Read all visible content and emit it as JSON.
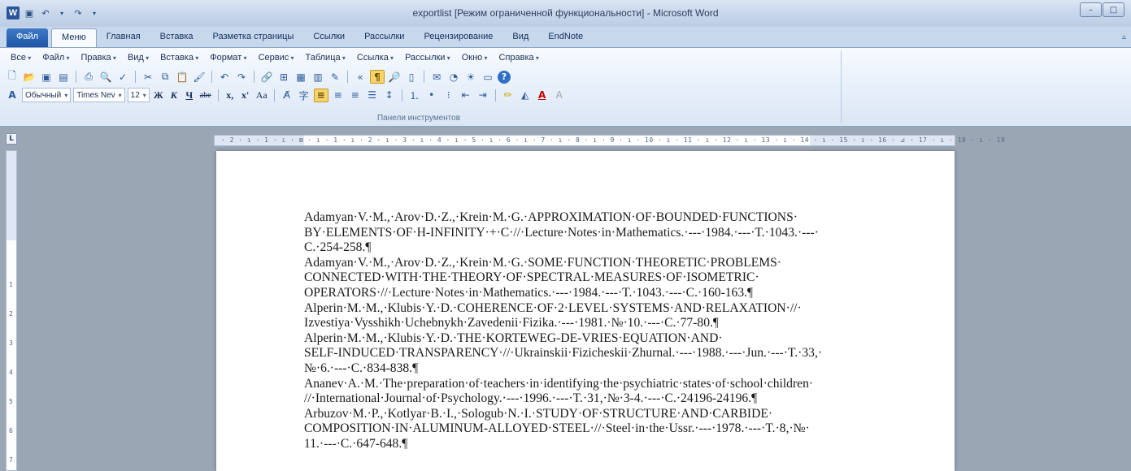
{
  "window": {
    "title": "exportlist [Режим ограниченной функциональности] - Microsoft Word",
    "qat_icons": [
      "word-logo",
      "save-icon",
      "undo-icon",
      "redo-icon",
      "customize-icon"
    ],
    "controls": {
      "minimize": "–",
      "maximize": "□"
    }
  },
  "tabs": [
    "Файл",
    "Меню",
    "Главная",
    "Вставка",
    "Разметка страницы",
    "Ссылки",
    "Рассылки",
    "Рецензирование",
    "Вид",
    "EndNote"
  ],
  "menu_bar": [
    "Все",
    "Файл",
    "Правка",
    "Вид",
    "Вставка",
    "Формат",
    "Сервис",
    "Таблица",
    "Ссылка",
    "Рассылки",
    "Окно",
    "Справка"
  ],
  "toolbar": {
    "style_combo": "Обычный",
    "font_combo": "Times Nev",
    "size_combo": "12",
    "bold": "Ж",
    "italic": "К",
    "underline": "Ч",
    "strike": "abe",
    "subscript": "x,",
    "superscript": "x'",
    "case": "Aa",
    "help": "?",
    "group_label": "Панели инструментов"
  },
  "ruler": {
    "h_marks": "· 2 · ı · 1 · ı · ⊠ · ı · 1 · ı · 2 · ı · 3 · ı · 4 · ı · 5 · ı · 6 · ı · 7 · ı · 8 · ı · 9 · ı · 10 · ı · 11 · ı · 12 · ı · 13 · ı · 14 · ı · 15 · ı · 16 · ⊿ · 17 · ı · 18 · ı · 19",
    "v_marks": [
      "1",
      "2",
      "3",
      "4",
      "5",
      "6",
      "7"
    ],
    "tab_selector": "L"
  },
  "document": {
    "lines": [
      "Adamyan·V.·M.,·Arov·D.·Z.,·Krein·M.·G.·APPROXIMATION·OF·BOUNDED·FUNCTIONS·",
      "BY·ELEMENTS·OF·H-INFINITY·+·C·//·Lecture·Notes·in·Mathematics.·---·1984.·---·T.·1043.·---·",
      "C.·254-258.¶",
      "Adamyan·V.·M.,·Arov·D.·Z.,·Krein·M.·G.·SOME·FUNCTION·THEORETIC·PROBLEMS·",
      "CONNECTED·WITH·THE·THEORY·OF·SPECTRAL·MEASURES·OF·ISOMETRIC·",
      "OPERATORS·//·Lecture·Notes·in·Mathematics.·---·1984.·---·T.·1043.·---·C.·160-163.¶",
      "Alperin·M.·M.,·Klubis·Y.·D.·COHERENCE·OF·2·LEVEL·SYSTEMS·AND·RELAXATION·//·",
      "Izvestiya·Vysshikh·Uchebnykh·Zavedenii·Fizika.·---·1981.·№·10.·---·C.·77-80.¶",
      "Alperin·M.·M.,·Klubis·Y.·D.·THE·KORTEWEG-DE-VRIES·EQUATION·AND·",
      "SELF-INDUCED·TRANSPARENCY·//·Ukrainskii·Fizicheskii·Zhurnal.·---·1988.·---·Jun.·---·T.·33,·",
      "№·6.·---·C.·834-838.¶",
      "Ananev·A.·M.·The·preparation·of·teachers·in·identifying·the·psychiatric·states·of·school·children·",
      "//·International·Journal·of·Psychology.·---·1996.·---·T.·31,·№·3-4.·---·C.·24196-24196.¶",
      "Arbuzov·M.·P.,·Kotlyar·B.·I.,·Sologub·N.·I.·STUDY·OF·STRUCTURE·AND·CARBIDE·",
      "COMPOSITION·IN·ALUMINUM-ALLOYED·STEEL·//·Steel·in·the·Ussr.·---·1978.·---·T.·8,·№·",
      "11.·---·C.·647-648.¶"
    ]
  }
}
